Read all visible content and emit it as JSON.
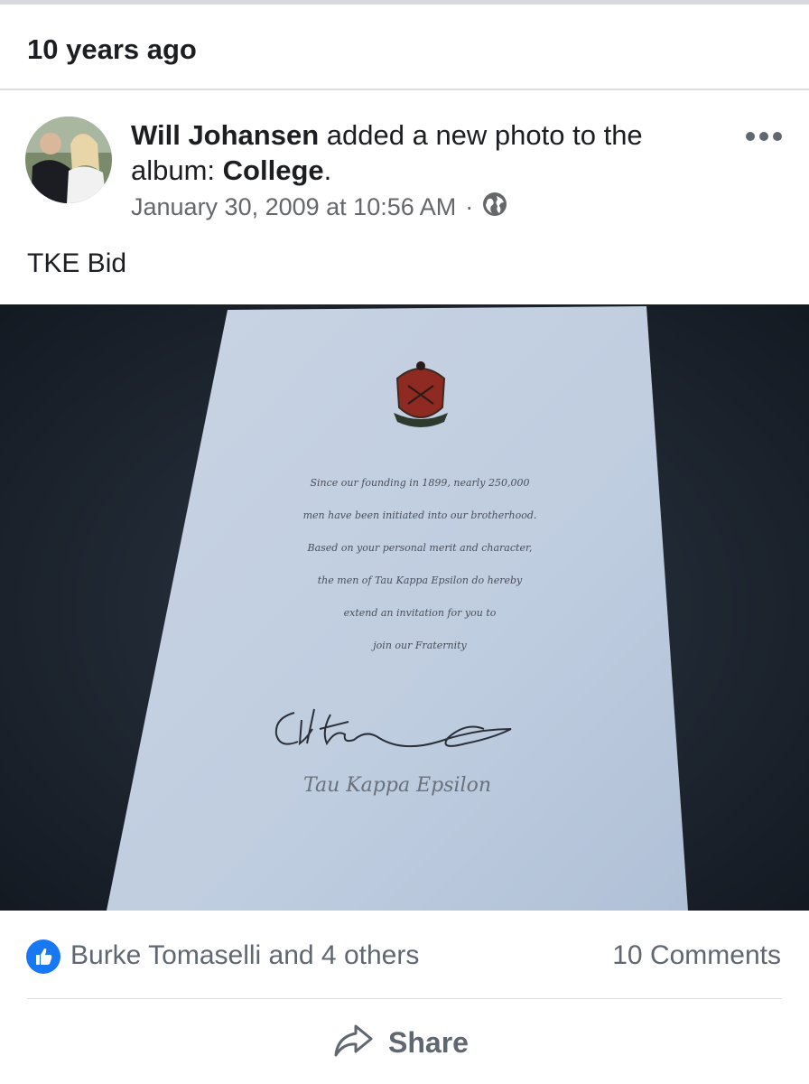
{
  "memory": {
    "title": "10 years ago"
  },
  "post": {
    "author": "Will Johansen",
    "action_text": " added a new photo to the album: ",
    "album": "College",
    "period": ".",
    "timestamp": "January 30, 2009 at 10:56 AM",
    "separator": "·",
    "privacy_icon": "globe-icon",
    "more_icon": "more-options-icon",
    "caption": "TKE Bid"
  },
  "photo": {
    "description_icon": "photo-of-fraternity-bid-letter",
    "crest_icon": "fraternity-crest-icon",
    "lines": [
      "Since our founding in 1899, nearly 250,000",
      "men have been initiated into our brotherhood.",
      "Based on your personal merit and character,",
      "the men of Tau Kappa Epsilon do hereby",
      "extend an invitation for you to",
      "join our Fraternity"
    ],
    "signature_name": "Tau Kappa Epsilon"
  },
  "reactions": {
    "like_icon": "thumbs-up-icon",
    "reactors": "Burke Tomaselli and 4 others",
    "comments": "10 Comments"
  },
  "actions": {
    "share_icon": "share-icon",
    "share_label": "Share"
  },
  "colors": {
    "accent": "#1877f2",
    "secondary_text": "#65676b",
    "primary_text": "#1c1e21"
  }
}
